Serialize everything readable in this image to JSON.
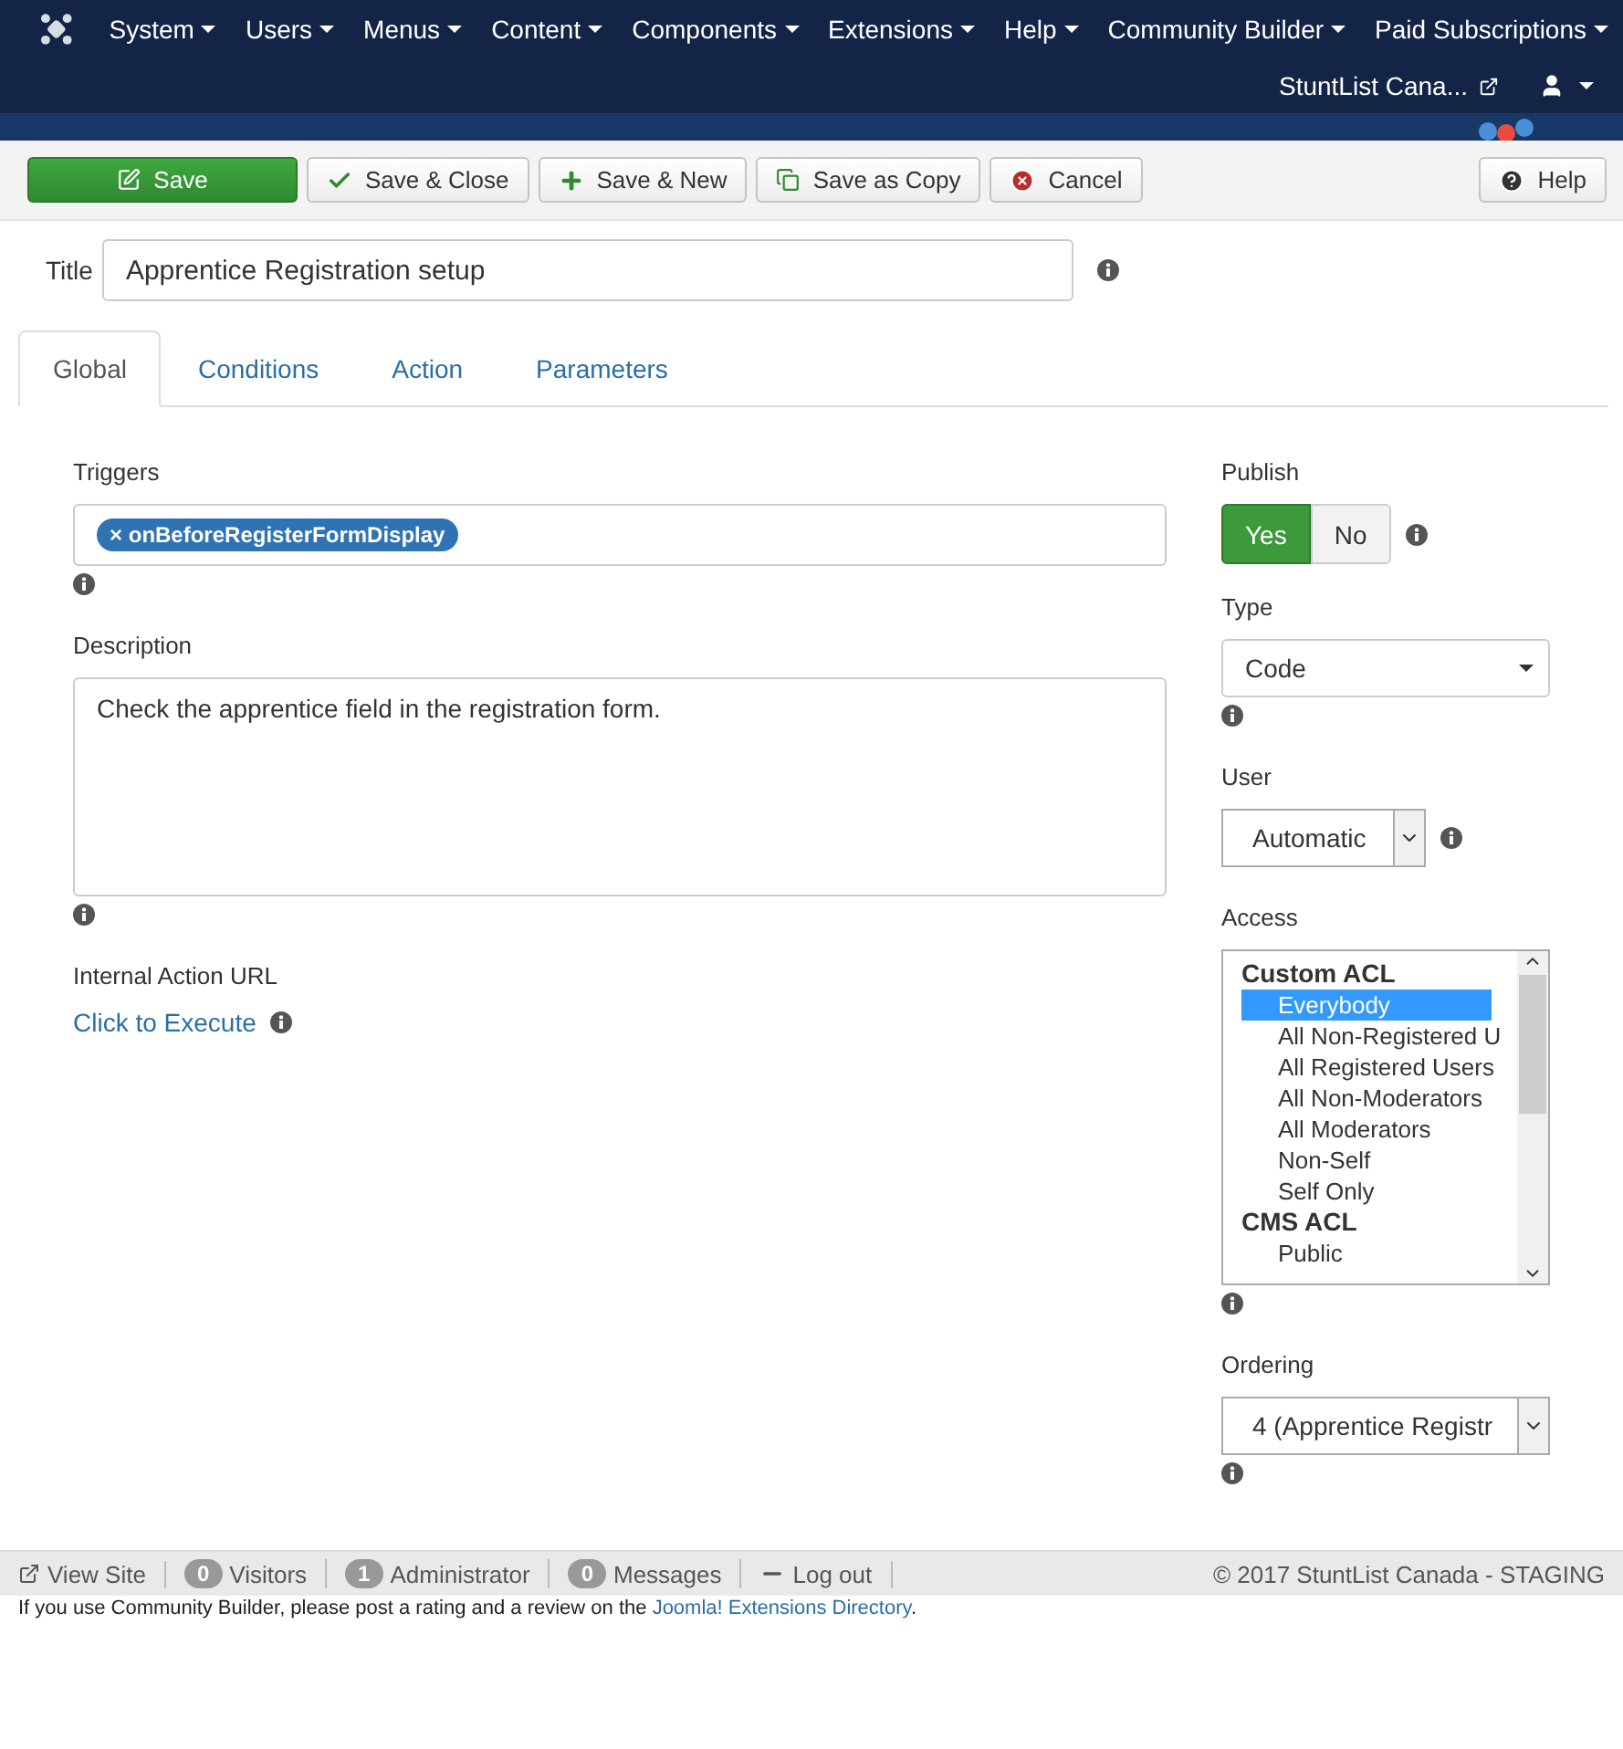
{
  "menu": [
    {
      "label": "System"
    },
    {
      "label": "Users"
    },
    {
      "label": "Menus"
    },
    {
      "label": "Content"
    },
    {
      "label": "Components"
    },
    {
      "label": "Extensions"
    },
    {
      "label": "Help"
    },
    {
      "label": "Community Builder"
    },
    {
      "label": "Paid Subscriptions"
    }
  ],
  "site_link": "StuntList Cana...",
  "toolbar": [
    {
      "label": "Save",
      "kind": "save"
    },
    {
      "label": "Save & Close",
      "kind": "check"
    },
    {
      "label": "Save & New",
      "kind": "new"
    },
    {
      "label": "Save as Copy",
      "kind": "copy"
    },
    {
      "label": "Cancel",
      "kind": "cancel"
    }
  ],
  "help": "Help",
  "title_field": {
    "label": "Title",
    "value": "Apprentice Registration setup"
  },
  "tabs": [
    {
      "label": "Global",
      "selected": true
    },
    {
      "label": "Conditions",
      "selected": false
    },
    {
      "label": "Action",
      "selected": false
    },
    {
      "label": "Parameters",
      "selected": false
    }
  ],
  "triggers": {
    "label": "Triggers",
    "tags": [
      {
        "remove": "×",
        "label": "onBeforeRegisterFormDisplay"
      }
    ]
  },
  "description": {
    "label": "Description",
    "value": "Check the apprentice field in the registration form."
  },
  "internal_url": {
    "label": "Internal Action URL",
    "link": "Click to Execute"
  },
  "publish": {
    "label": "Publish",
    "options": [
      {
        "label": "Yes",
        "selected": true
      },
      {
        "label": "No",
        "selected": false
      }
    ]
  },
  "type": {
    "label": "Type",
    "value": "Code"
  },
  "user": {
    "label": "User",
    "value": "Automatic"
  },
  "access": {
    "label": "Access",
    "groups": [
      {
        "label": "Custom ACL",
        "options": [
          {
            "label": "Everybody",
            "selected": true
          },
          {
            "label": "All Non-Registered U",
            "selected": false
          },
          {
            "label": "All Registered Users",
            "selected": false
          },
          {
            "label": "All Non-Moderators",
            "selected": false
          },
          {
            "label": "All Moderators",
            "selected": false
          },
          {
            "label": "Non-Self",
            "selected": false
          },
          {
            "label": "Self Only",
            "selected": false
          }
        ]
      },
      {
        "label": "CMS ACL",
        "options": [
          {
            "label": "Public",
            "selected": false
          }
        ]
      }
    ]
  },
  "ordering": {
    "label": "Ordering",
    "value": "4 (Apprentice Registr"
  },
  "status_bar": {
    "items": [
      {
        "kind": "link",
        "label": "View Site"
      },
      {
        "kind": "count",
        "count": "0",
        "label": "Visitors"
      },
      {
        "kind": "count",
        "count": "1",
        "label": "Administrator"
      },
      {
        "kind": "count",
        "count": "0",
        "label": "Messages"
      },
      {
        "kind": "logout",
        "label": "Log out"
      }
    ],
    "copyright": "© 2017 StuntList Canada - STAGING"
  },
  "footer_note": {
    "before": "If you use Community Builder, please post a rating and a review on the",
    "link": "Joomla! Extensions Directory",
    "after": "."
  }
}
